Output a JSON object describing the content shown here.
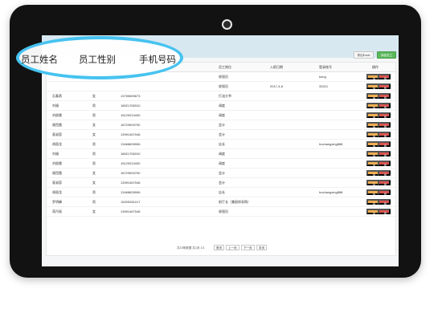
{
  "toolbar": {
    "export_label": "导出Excel",
    "add_label": "添加员工"
  },
  "table": {
    "headers": [
      "员工岗位",
      "入职日期",
      "登录账号",
      "操作"
    ],
    "rows": [
      {
        "name": "",
        "gender": "",
        "phone": "",
        "position": "收银员",
        "date": "",
        "account": "kong"
      },
      {
        "name": "",
        "gender": "",
        "phone": "",
        "position": "收银员",
        "date": "2017-4-6",
        "account": "33221"
      },
      {
        "name": "石春燕",
        "gender": "女",
        "phone": "13759890673",
        "position": "打油大爷",
        "date": "",
        "account": ""
      },
      {
        "name": "刘福",
        "gender": "男",
        "phone": "18521765310",
        "position": "调度",
        "date": "",
        "account": ""
      },
      {
        "name": "刘俊雷",
        "gender": "男",
        "phone": "15129224430",
        "position": "调度",
        "date": "",
        "account": ""
      },
      {
        "name": "谢西霞",
        "gender": "女",
        "phone": "18729593790",
        "position": "会计",
        "date": "",
        "account": ""
      },
      {
        "name": "袁淑容",
        "gender": "女",
        "phone": "13991467048",
        "position": "会计",
        "date": "",
        "account": ""
      },
      {
        "name": "胡昌龙",
        "gender": "男",
        "phone": "13468826906",
        "position": "店长",
        "date": "",
        "account": "huchangxing888"
      },
      {
        "name": "刘福",
        "gender": "男",
        "phone": "18521765310",
        "position": "调度",
        "date": "",
        "account": ""
      },
      {
        "name": "刘俊雷",
        "gender": "男",
        "phone": "15129224430",
        "position": "调度",
        "date": "",
        "account": ""
      },
      {
        "name": "谢西霞",
        "gender": "女",
        "phone": "18729593790",
        "position": "会计",
        "date": "",
        "account": ""
      },
      {
        "name": "袁淑容",
        "gender": "女",
        "phone": "13991467048",
        "position": "会计",
        "date": "",
        "account": ""
      },
      {
        "name": "胡昌龙",
        "gender": "男",
        "phone": "13468826906",
        "position": "店长",
        "date": "",
        "account": "huchangxing888"
      },
      {
        "name": "罗明峰",
        "gender": "男",
        "phone": "15209281017",
        "position": "前厅长（兼厨房采购）",
        "date": "",
        "account": ""
      },
      {
        "name": "蒋丹丽",
        "gender": "女",
        "phone": "13991467048",
        "position": "收银员",
        "date": "",
        "account": ""
      }
    ],
    "edit_label": "编辑",
    "delete_label": "删除"
  },
  "pagination": {
    "info": "共15条数据 共1页",
    "current": "1/1",
    "first": "首页",
    "prev": "上一页",
    "next": "下一页",
    "last": "末页"
  },
  "highlight": {
    "name_header": "员工姓名",
    "gender_header": "员工性别",
    "phone_header": "手机号码"
  },
  "colors": {
    "ellipse": "#46c3f0",
    "edit": "#f0ad4e",
    "delete": "#d9534f",
    "add": "#5cb85c",
    "topbar": "#d8e8f1"
  }
}
